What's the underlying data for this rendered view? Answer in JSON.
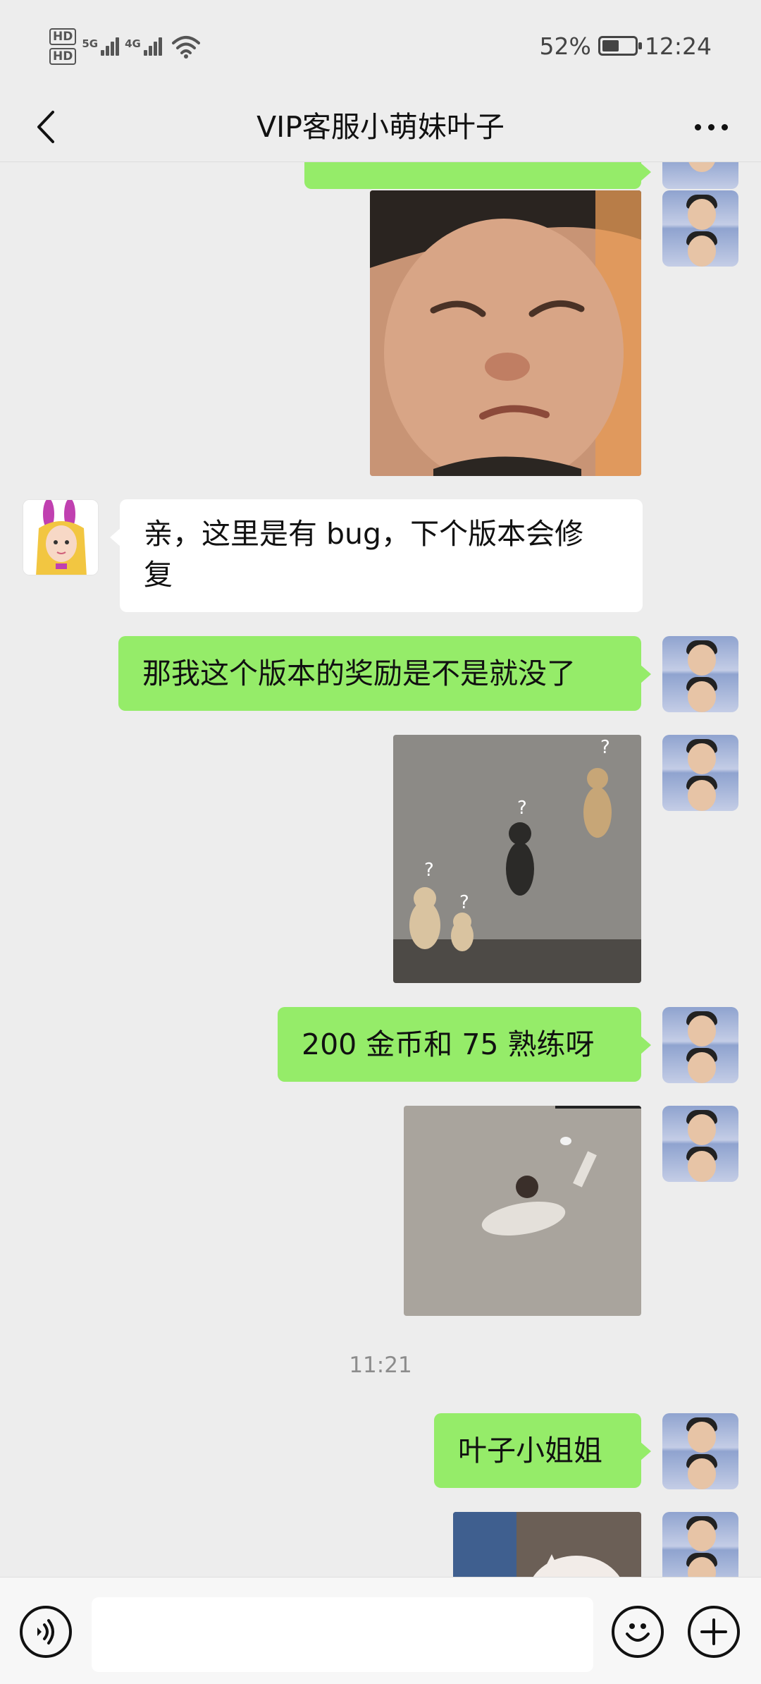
{
  "status_bar": {
    "hd1": "HD",
    "hd2": "HD",
    "net1": "5G",
    "net2": "4G",
    "battery_text": "52%",
    "battery_level": 0.52,
    "time": "12:24"
  },
  "header": {
    "title": "VIP客服小萌妹叶子",
    "back_icon": "chevron-left-icon",
    "more_icon": "more-dots-icon"
  },
  "messages": [
    {
      "type": "text",
      "side": "right",
      "text": ""
    },
    {
      "type": "image",
      "side": "right",
      "subject": "crying boy close-up"
    },
    {
      "type": "text",
      "side": "left",
      "text": "亲，这里是有 bug，下个版本会修复"
    },
    {
      "type": "text",
      "side": "right",
      "text": "那我这个版本的奖励是不是就没了"
    },
    {
      "type": "image",
      "side": "right",
      "subject": "four puzzled dogs"
    },
    {
      "type": "text",
      "side": "right",
      "text": "200 金币和 75 熟练呀"
    },
    {
      "type": "image",
      "side": "right",
      "subject": "child lying on ground"
    },
    {
      "type": "time",
      "text": "11:21"
    },
    {
      "type": "text",
      "side": "right",
      "text": "叶子小姐姐"
    },
    {
      "type": "image",
      "side": "right",
      "subject": "white cat"
    }
  ],
  "msg_text": {
    "m3_line1": "亲，这里是有 bug，下个版本会修",
    "m3_line2": "复",
    "m4": "那我这个版本的奖励是不是就没了",
    "m6": "200 金币和 75 熟练呀",
    "time1": "11:21",
    "m9": "叶子小姐姐"
  },
  "input_bar": {
    "voice_icon": "voice-icon",
    "input_value": "",
    "emoji_icon": "emoji-icon",
    "plus_icon": "plus-icon"
  },
  "colors": {
    "background": "#ededed",
    "bubble_green": "#95ec69",
    "bubble_white": "#ffffff",
    "timestamp": "#8c8c8c"
  }
}
